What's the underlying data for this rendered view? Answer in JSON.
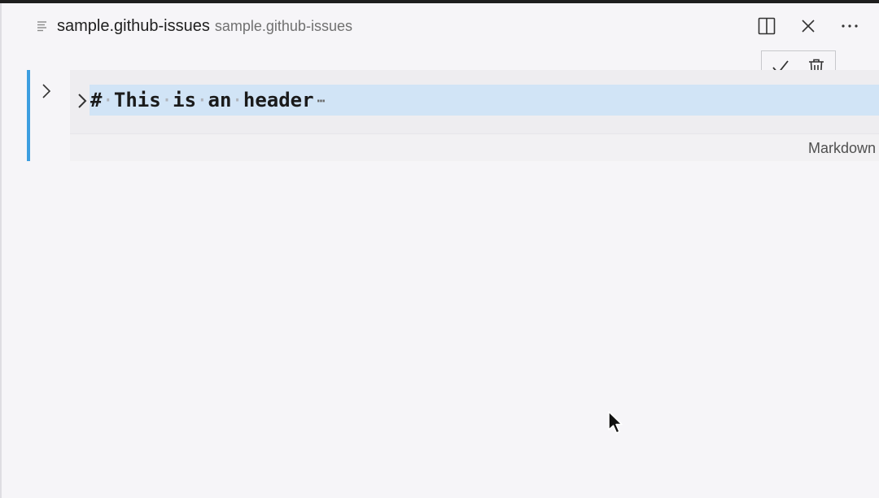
{
  "editor": {
    "tab_title": "sample.github-issues",
    "tab_description": "sample.github-issues"
  },
  "header_actions": {
    "split_icon": "split-editor-icon",
    "close_icon": "close-icon",
    "more_icon": "more-actions-icon"
  },
  "cell_toolbar": {
    "confirm_icon": "check-icon",
    "delete_icon": "trash-icon"
  },
  "cell": {
    "code_tokens": [
      "#",
      "This",
      "is",
      "an",
      "header"
    ],
    "whitespace_marker": "·",
    "folded_marker": "⋯",
    "language": "Markdown"
  },
  "colors": {
    "background": "#f6f5f8",
    "focus_indicator": "#3d9ee0",
    "line_highlight": "#d1e4f6",
    "cell_background": "#eeedf0"
  }
}
